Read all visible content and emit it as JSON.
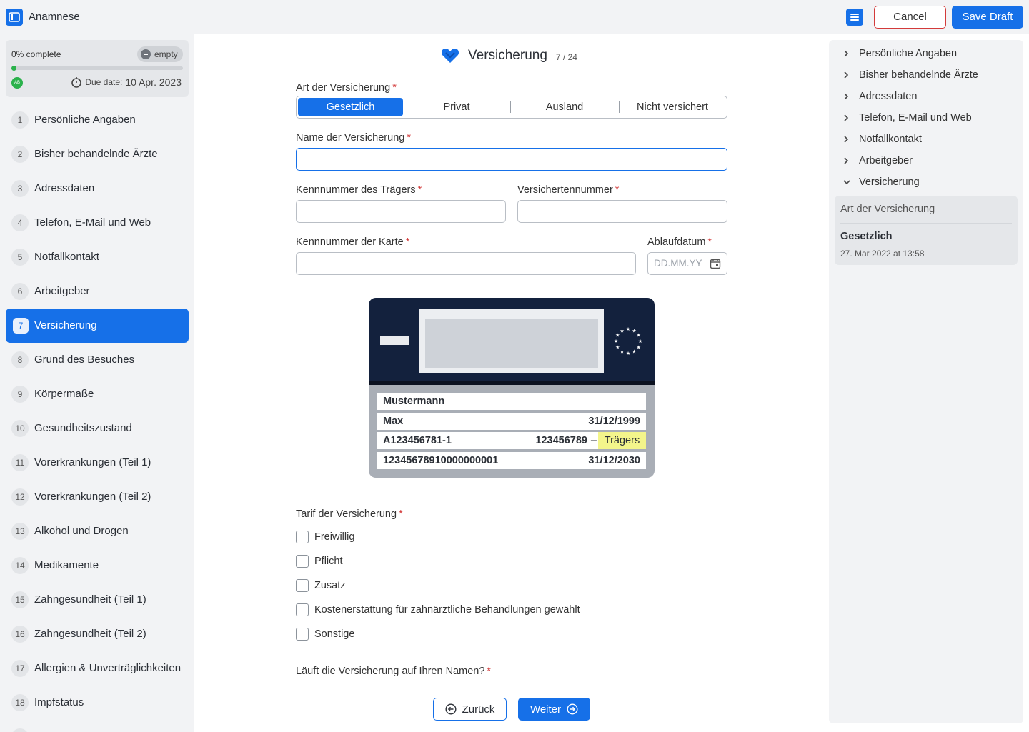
{
  "app": {
    "title": "Anamnese"
  },
  "toolbar": {
    "cancel_label": "Cancel",
    "save_label": "Save Draft"
  },
  "progress": {
    "label": "0% complete",
    "status": "empty",
    "percent": 0,
    "avatar_initials": "AB",
    "due_label": "Due date:",
    "due_value": "10 Apr. 2023"
  },
  "nav": {
    "items": [
      {
        "num": "1",
        "label": "Persönliche Angaben"
      },
      {
        "num": "2",
        "label": "Bisher behandelnde Ärzte"
      },
      {
        "num": "3",
        "label": "Adressdaten"
      },
      {
        "num": "4",
        "label": "Telefon, E-Mail und Web"
      },
      {
        "num": "5",
        "label": "Notfallkontakt"
      },
      {
        "num": "6",
        "label": "Arbeitgeber"
      },
      {
        "num": "7",
        "label": "Versicherung"
      },
      {
        "num": "8",
        "label": "Grund des Besuches"
      },
      {
        "num": "9",
        "label": "Körpermaße"
      },
      {
        "num": "10",
        "label": "Gesundheitszustand"
      },
      {
        "num": "11",
        "label": "Vorerkrankungen (Teil 1)"
      },
      {
        "num": "12",
        "label": "Vorerkrankungen (Teil 2)"
      },
      {
        "num": "13",
        "label": "Alkohol und Drogen"
      },
      {
        "num": "14",
        "label": "Medikamente"
      },
      {
        "num": "15",
        "label": "Zahngesundheit (Teil 1)"
      },
      {
        "num": "16",
        "label": "Zahngesundheit (Teil 2)"
      },
      {
        "num": "17",
        "label": "Allergien & Unverträglichkeiten"
      },
      {
        "num": "18",
        "label": "Impfstatus"
      }
    ],
    "active_index": 6
  },
  "section": {
    "title": "Versicherung",
    "count": "7 / 24"
  },
  "form": {
    "art_label": "Art der Versicherung",
    "art_options": [
      "Gesetzlich",
      "Privat",
      "Ausland",
      "Nicht versichert"
    ],
    "art_selected": "Gesetzlich",
    "name_label": "Name der Versicherung",
    "name_value": "",
    "traeger_label": "Kennnummer des Trägers",
    "versicherten_label": "Versichertennummer",
    "karte_label": "Kennnummer der Karte",
    "ablauf_label": "Ablaufdatum",
    "ablauf_placeholder": "DD.MM.YY",
    "required_mark": "*",
    "tarif_label": "Tarif der Versicherung",
    "tarif_options": [
      "Freiwillig",
      "Pflicht",
      "Zusatz",
      "Kostenerstattung für zahnärztliche Behandlungen gewählt",
      "Sonstige"
    ],
    "namen_question": "Läuft die Versicherung auf Ihren Namen?"
  },
  "card": {
    "surname": "Mustermann",
    "firstname": "Max",
    "birthdate": "31/12/1999",
    "insured_no": "A123456781-1",
    "carrier_no": "123456789",
    "carrier_dash": "–",
    "carrier_highlight": "Trägers",
    "card_no": "12345678910000000001",
    "expiry": "31/12/2030"
  },
  "buttons": {
    "back": "Zurück",
    "next": "Weiter"
  },
  "outline": {
    "items": [
      "Persönliche Angaben",
      "Bisher behandelnde Ärzte",
      "Adressdaten",
      "Telefon, E-Mail und Web",
      "Notfallkontakt",
      "Arbeitgeber",
      "Versicherung"
    ],
    "detail_question": "Art der Versicherung",
    "detail_answer": "Gesetzlich",
    "detail_time": "27. Mar 2022 at 13:58"
  },
  "colors": {
    "accent": "#1670e8",
    "danger": "#d33a3a",
    "success": "#2bb24c",
    "card_dark": "#13213d",
    "highlight": "#f3f58b"
  }
}
